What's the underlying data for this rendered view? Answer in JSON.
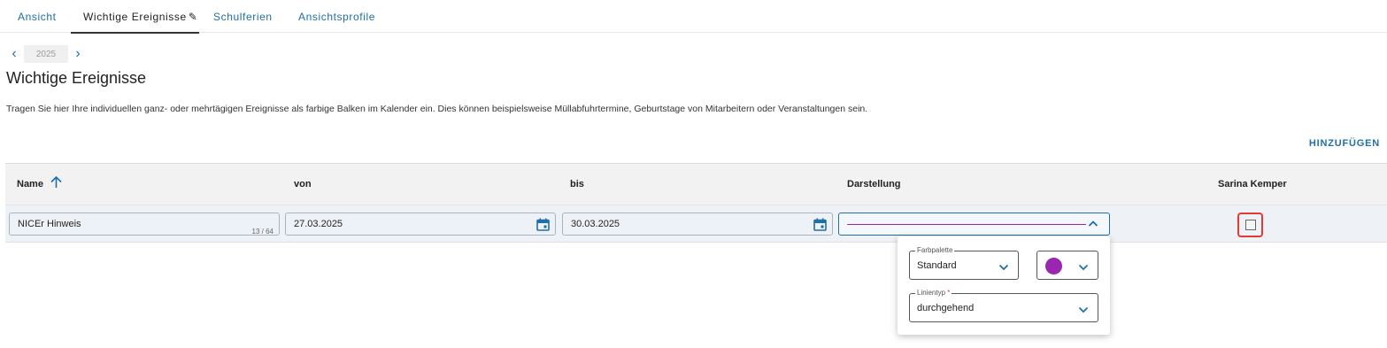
{
  "tabs": [
    {
      "label": "Ansicht"
    },
    {
      "label": "Wichtige Ereignisse"
    },
    {
      "label": "Schulferien"
    },
    {
      "label": "Ansichtsprofile"
    }
  ],
  "year": "2025",
  "page": {
    "title": "Wichtige Ereignisse",
    "description": "Tragen Sie hier Ihre individuellen ganz- oder mehrtägigen Ereignisse als farbige Balken im Kalender ein. Dies können beispielsweise Müllabfuhrtermine, Geburtstage von Mitarbeitern oder Veranstaltungen sein.",
    "add_label": "HINZUFÜGEN"
  },
  "table": {
    "headers": {
      "name": "Name",
      "von": "von",
      "bis": "bis",
      "darstellung": "Darstellung",
      "person": "Sarina Kemper"
    },
    "row": {
      "name": "NICEr Hinweis",
      "name_counter": "13 / 64",
      "von": "27.03.2025",
      "bis": "30.03.2025",
      "checked": false
    }
  },
  "display_popup": {
    "palette_label": "Farbpalette",
    "palette_value": "Standard",
    "line_label": "Linientyp",
    "line_required": "*",
    "line_value": "durchgehend",
    "color": "#9b27b0"
  },
  "colors": {
    "accent": "#1f6fa8",
    "line_color": "#9b27b0",
    "highlight": "#e53935"
  },
  "icons": {
    "edit": "pencil-icon",
    "sort": "arrow-up-icon",
    "calendar": "calendar-icon",
    "prev": "chevron-left-icon",
    "next": "chevron-right-icon"
  }
}
